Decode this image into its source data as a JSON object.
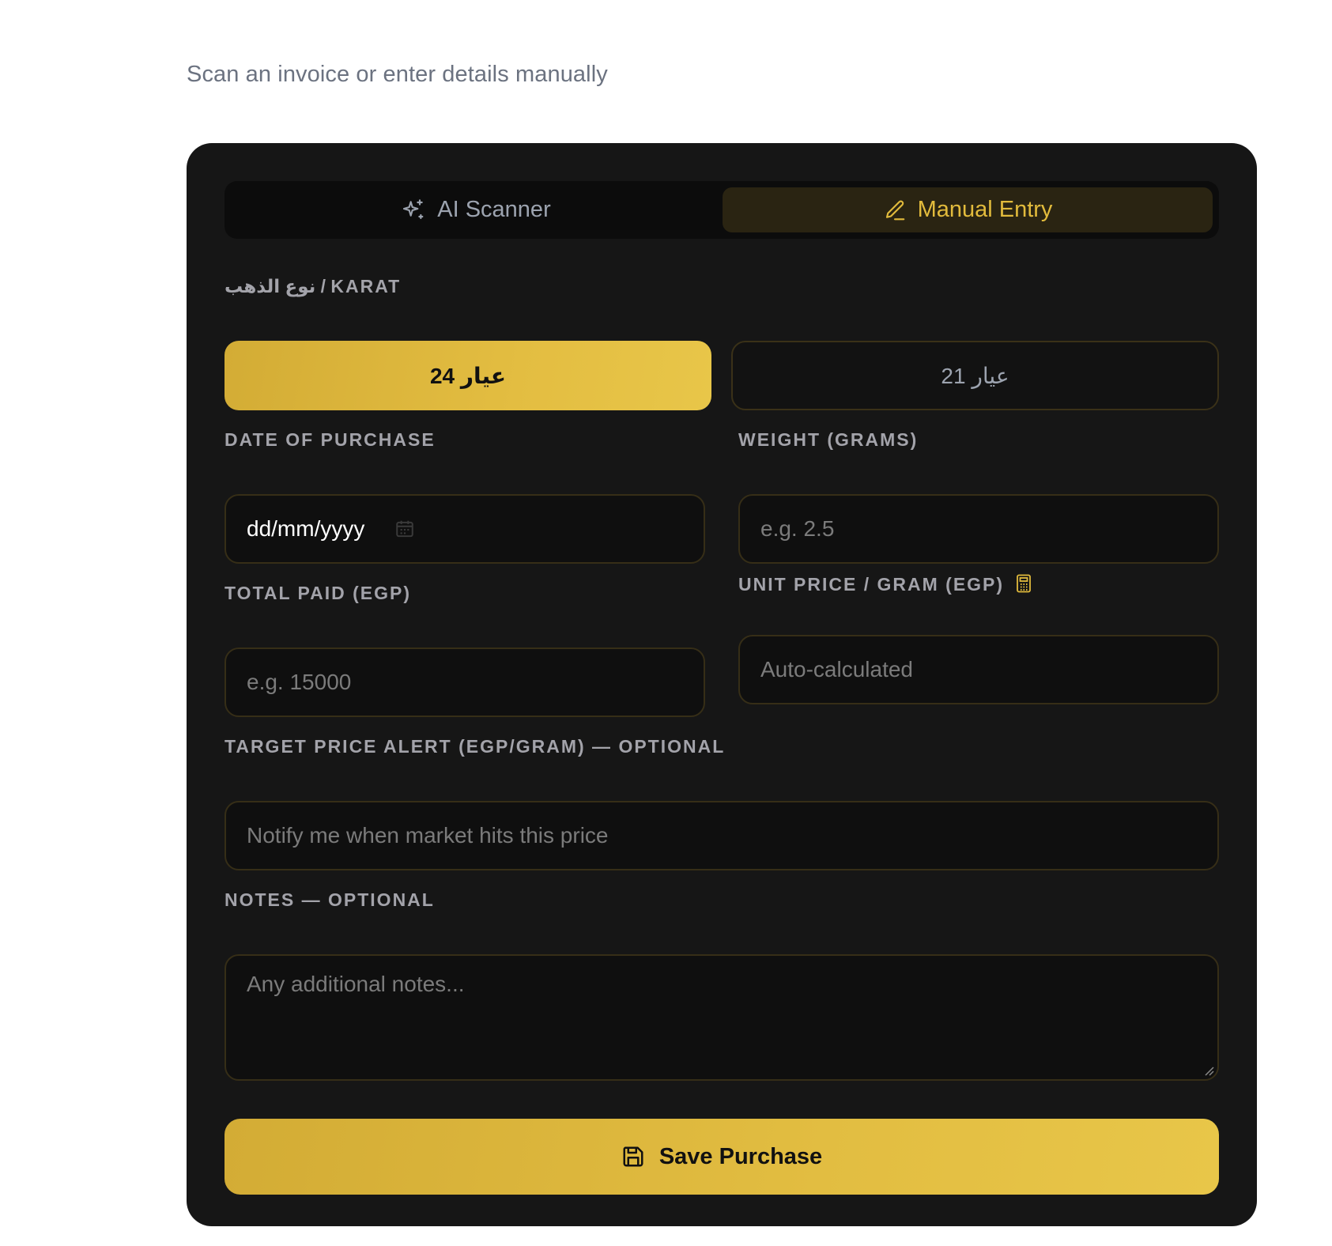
{
  "header": {
    "subtitle": "Scan an invoice or enter details manually"
  },
  "tabs": [
    {
      "label": "AI Scanner",
      "icon": "sparkles-icon",
      "active": false
    },
    {
      "label": "Manual Entry",
      "icon": "pencil-icon",
      "active": true
    }
  ],
  "form": {
    "karat_label": "نوع الذهب / KARAT",
    "karat_options": [
      "عيار 24",
      "عيار 21"
    ],
    "karat_selected": "عيار 24",
    "date_label": "DATE OF PURCHASE",
    "date_value": "dd/mm/yyyy",
    "weight_label": "WEIGHT (GRAMS)",
    "weight_placeholder": "e.g. 2.5",
    "total_label": "TOTAL PAID (EGP)",
    "total_placeholder": "e.g. 15000",
    "unit_price_label": "UNIT PRICE / GRAM (EGP)",
    "unit_price_placeholder": "Auto-calculated",
    "target_label": "TARGET PRICE ALERT (EGP/GRAM) — OPTIONAL",
    "target_placeholder": "Notify me when market hits this price",
    "notes_label": "NOTES — OPTIONAL",
    "notes_placeholder": "Any additional notes...",
    "save_label": "Save Purchase"
  },
  "colors": {
    "gold": "#e2bb3c",
    "card_bg": "#161616",
    "field_bg": "#0f0f0f",
    "field_border": "#362e17"
  }
}
